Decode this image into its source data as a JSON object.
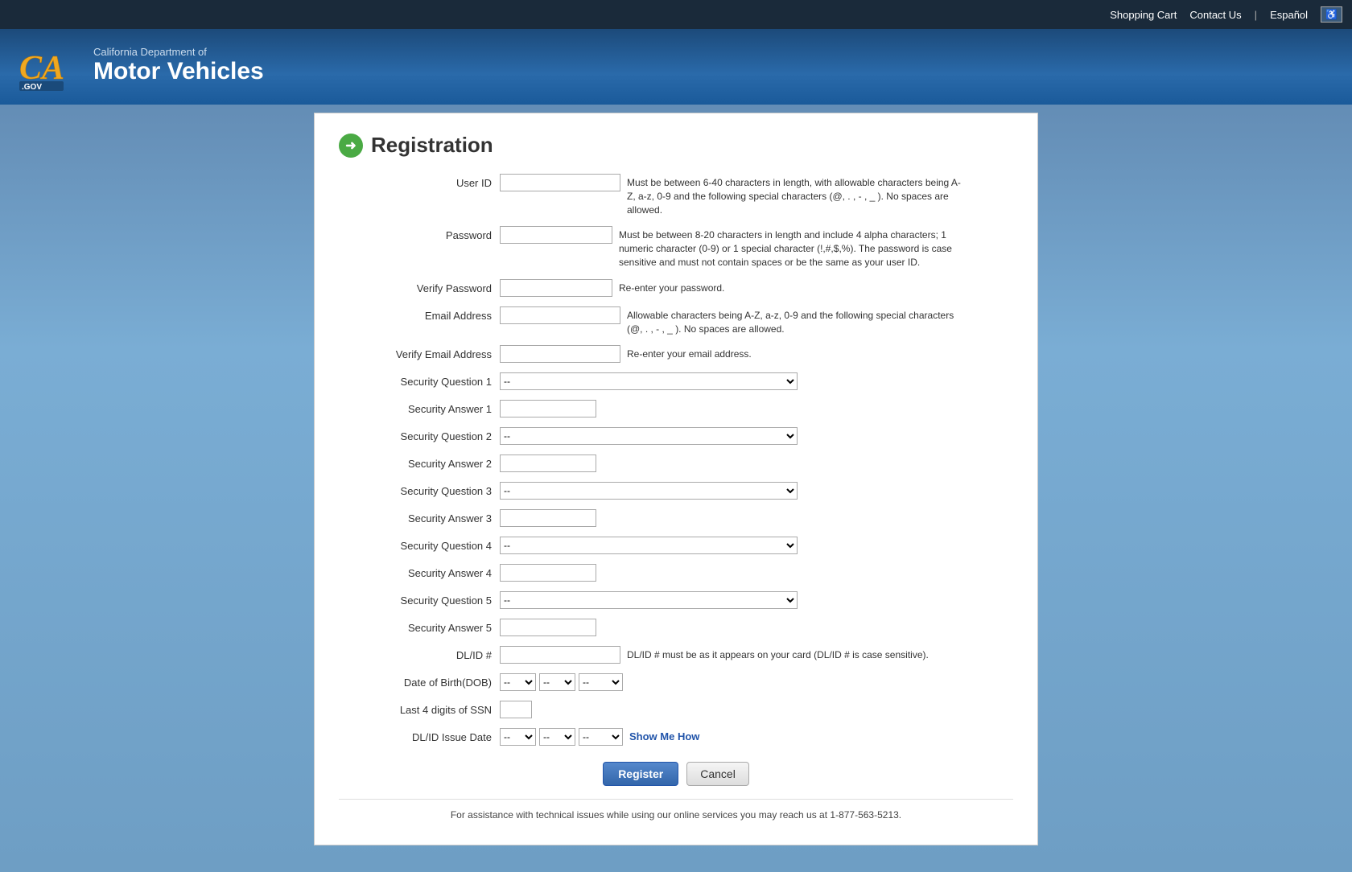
{
  "topnav": {
    "shopping_cart": "Shopping Cart",
    "contact_us": "Contact Us",
    "espanol": "Español",
    "accessibility_icon": "♿"
  },
  "header": {
    "dept_line1": "California Department of",
    "dept_line2": "Motor Vehicles",
    "ca_gov": "CA.GOV"
  },
  "page": {
    "title": "Registration",
    "icon_arrow": "➜"
  },
  "form": {
    "user_id_label": "User ID",
    "user_id_hint": "Must be between 6-40 characters in length, with allowable characters being A-Z, a-z, 0-9 and the following special characters (@, . , - , _ ). No spaces are allowed.",
    "password_label": "Password",
    "password_hint": "Must be between 8-20 characters in length and include 4 alpha characters; 1 numeric character (0-9) or 1 special character (!,#,$,%). The password is case sensitive and must not contain spaces or be the same as your user ID.",
    "verify_password_label": "Verify Password",
    "verify_password_hint": "Re-enter your password.",
    "email_label": "Email Address",
    "email_hint": "Allowable characters being A-Z, a-z, 0-9 and the following special characters (@, . , - , _ ). No spaces are allowed.",
    "verify_email_label": "Verify Email Address",
    "verify_email_hint": "Re-enter your email address.",
    "sec_q1_label": "Security Question 1",
    "sec_a1_label": "Security Answer 1",
    "sec_q2_label": "Security Question 2",
    "sec_a2_label": "Security Answer 2",
    "sec_q3_label": "Security Question 3",
    "sec_a3_label": "Security Answer 3",
    "sec_q4_label": "Security Question 4",
    "sec_a4_label": "Security Answer 4",
    "sec_q5_label": "Security Question 5",
    "sec_a5_label": "Security Answer 5",
    "dlid_label": "DL/ID #",
    "dlid_hint": "DL/ID # must be as it appears on your card (DL/ID # is case sensitive).",
    "dob_label": "Date of Birth(DOB)",
    "ssn_label": "Last 4 digits of SSN",
    "issue_date_label": "DL/ID Issue Date",
    "show_me_how": "Show Me How",
    "register_btn": "Register",
    "cancel_btn": "Cancel",
    "footer_note": "For assistance with technical issues while using our online services you may reach us at 1-877-563-5213.",
    "dropdown_default": "--"
  }
}
